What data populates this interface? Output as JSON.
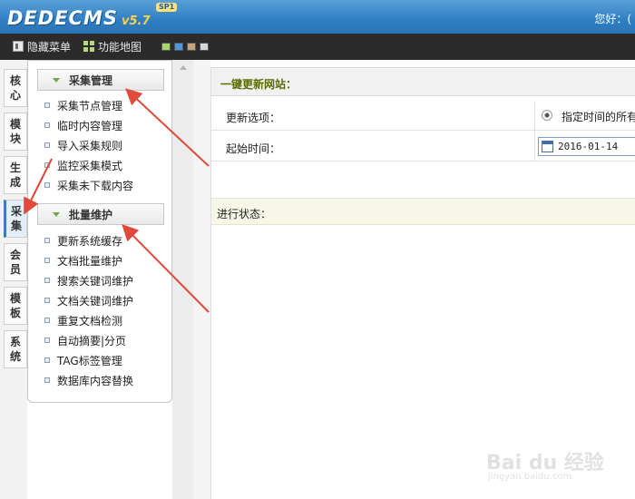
{
  "header": {
    "logo_text": "DEDECMS",
    "logo_version": "v5.7",
    "logo_badge": "SP1",
    "greeting": "您好：("
  },
  "toolbar": {
    "hide_menu_label": "隐藏菜单",
    "func_map_label": "功能地图",
    "skin_colors": [
      "#a8d66b",
      "#4f97d6",
      "#c8a27a",
      "#d7d7d7"
    ]
  },
  "tabs": [
    {
      "label": "核心",
      "active": false
    },
    {
      "label": "模块",
      "active": false
    },
    {
      "label": "生成",
      "active": false
    },
    {
      "label": "采集",
      "active": true
    },
    {
      "label": "会员",
      "active": false
    },
    {
      "label": "模板",
      "active": false
    },
    {
      "label": "系统",
      "active": false
    }
  ],
  "menu": {
    "groups": [
      {
        "title": "采集管理",
        "items": [
          "采集节点管理",
          "临时内容管理",
          "导入采集规则",
          "监控采集模式",
          "采集未下载内容"
        ]
      },
      {
        "title": "批量维护",
        "items": [
          "更新系统缓存",
          "文档批量维护",
          "搜索关键词维护",
          "文档关键词维护",
          "重复文档检测",
          "自动摘要|分页",
          "TAG标签管理",
          "数据库内容替换"
        ]
      }
    ]
  },
  "main": {
    "title": "一键更新网站：",
    "update_option_label": "更新选项：",
    "update_option_value": "指定时间的所有",
    "start_time_label": "起始时间：",
    "start_time_value": "2016-01-14",
    "status_label": "进行状态："
  },
  "watermark": {
    "text": "Bai du 经验",
    "url": "jingyan.baidu.com"
  },
  "colors": {
    "header": "#2f7fc4",
    "toolbar": "#2b2b2b",
    "annotation_arrow": "#e04a3a",
    "title_text": "#5b6b00"
  }
}
